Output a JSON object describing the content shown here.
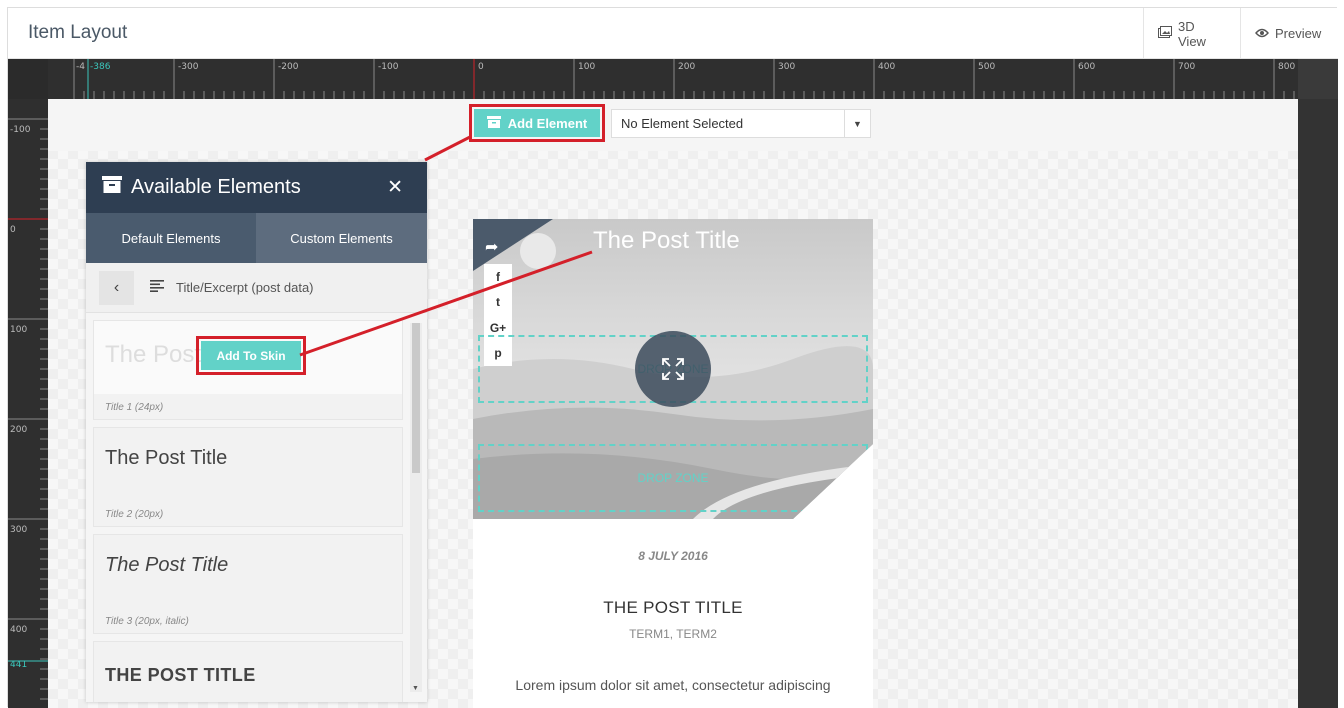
{
  "header": {
    "title": "Item Layout",
    "view_3d_label": "3D View",
    "preview_label": "Preview"
  },
  "ruler": {
    "h_labels": [
      "-4",
      "-386",
      "-300",
      "-200",
      "-100",
      "0",
      "100",
      "200",
      "300",
      "400",
      "500",
      "600",
      "700",
      "800"
    ],
    "v_labels": [
      "-100",
      "0",
      "100",
      "200",
      "300",
      "400",
      "441"
    ]
  },
  "toolbar": {
    "add_element_label": "Add Element",
    "element_select_value": "No Element Selected"
  },
  "panel": {
    "title": "Available Elements",
    "tabs": [
      "Default Elements",
      "Custom Elements"
    ],
    "breadcrumb": "Title/Excerpt (post data)",
    "add_to_skin_label": "Add To Skin",
    "items": [
      {
        "preview": "The Post Title",
        "caption": "Title 1 (24px)"
      },
      {
        "preview": "The Post Title",
        "caption": "Title 2 (20px)"
      },
      {
        "preview": "The Post Title",
        "caption": "Title 3 (20px, italic)"
      },
      {
        "preview": "THE POST TITLE",
        "caption": ""
      }
    ]
  },
  "preview": {
    "hero_title": "The Post Title",
    "dropzone_1": "DROP ZONE",
    "dropzone_2": "DROP ZONE",
    "date": "8 JULY 2016",
    "title": "THE POST TITLE",
    "terms": "TERM1, TERM2",
    "excerpt": "Lorem ipsum dolor sit amet, consectetur adipiscing"
  },
  "colors": {
    "accent": "#62d2c8",
    "panel_header": "#2e3e52",
    "highlight": "#d4202a"
  }
}
